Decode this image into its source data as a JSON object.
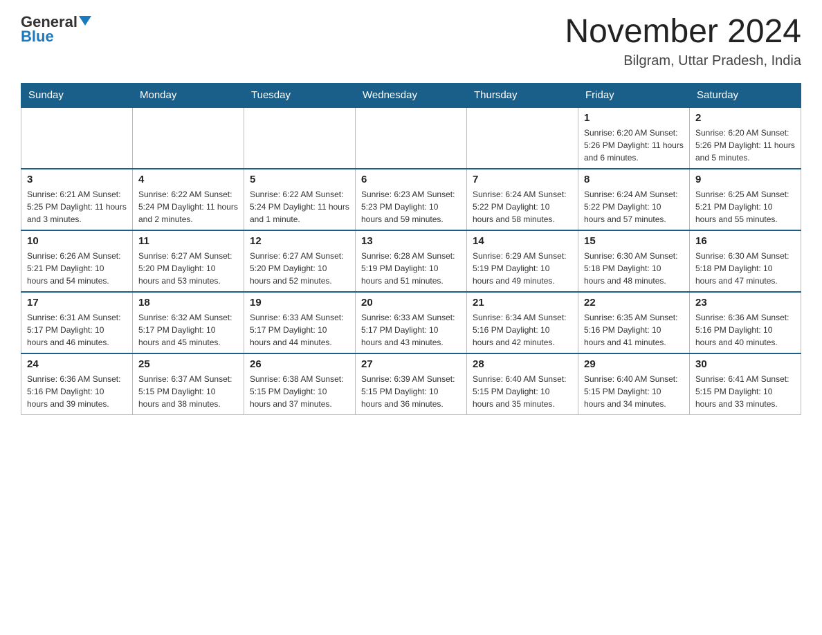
{
  "header": {
    "logo_general": "General",
    "logo_blue": "Blue",
    "title": "November 2024",
    "subtitle": "Bilgram, Uttar Pradesh, India"
  },
  "calendar": {
    "days_of_week": [
      "Sunday",
      "Monday",
      "Tuesday",
      "Wednesday",
      "Thursday",
      "Friday",
      "Saturday"
    ],
    "weeks": [
      [
        {
          "day": "",
          "info": ""
        },
        {
          "day": "",
          "info": ""
        },
        {
          "day": "",
          "info": ""
        },
        {
          "day": "",
          "info": ""
        },
        {
          "day": "",
          "info": ""
        },
        {
          "day": "1",
          "info": "Sunrise: 6:20 AM\nSunset: 5:26 PM\nDaylight: 11 hours and 6 minutes."
        },
        {
          "day": "2",
          "info": "Sunrise: 6:20 AM\nSunset: 5:26 PM\nDaylight: 11 hours and 5 minutes."
        }
      ],
      [
        {
          "day": "3",
          "info": "Sunrise: 6:21 AM\nSunset: 5:25 PM\nDaylight: 11 hours and 3 minutes."
        },
        {
          "day": "4",
          "info": "Sunrise: 6:22 AM\nSunset: 5:24 PM\nDaylight: 11 hours and 2 minutes."
        },
        {
          "day": "5",
          "info": "Sunrise: 6:22 AM\nSunset: 5:24 PM\nDaylight: 11 hours and 1 minute."
        },
        {
          "day": "6",
          "info": "Sunrise: 6:23 AM\nSunset: 5:23 PM\nDaylight: 10 hours and 59 minutes."
        },
        {
          "day": "7",
          "info": "Sunrise: 6:24 AM\nSunset: 5:22 PM\nDaylight: 10 hours and 58 minutes."
        },
        {
          "day": "8",
          "info": "Sunrise: 6:24 AM\nSunset: 5:22 PM\nDaylight: 10 hours and 57 minutes."
        },
        {
          "day": "9",
          "info": "Sunrise: 6:25 AM\nSunset: 5:21 PM\nDaylight: 10 hours and 55 minutes."
        }
      ],
      [
        {
          "day": "10",
          "info": "Sunrise: 6:26 AM\nSunset: 5:21 PM\nDaylight: 10 hours and 54 minutes."
        },
        {
          "day": "11",
          "info": "Sunrise: 6:27 AM\nSunset: 5:20 PM\nDaylight: 10 hours and 53 minutes."
        },
        {
          "day": "12",
          "info": "Sunrise: 6:27 AM\nSunset: 5:20 PM\nDaylight: 10 hours and 52 minutes."
        },
        {
          "day": "13",
          "info": "Sunrise: 6:28 AM\nSunset: 5:19 PM\nDaylight: 10 hours and 51 minutes."
        },
        {
          "day": "14",
          "info": "Sunrise: 6:29 AM\nSunset: 5:19 PM\nDaylight: 10 hours and 49 minutes."
        },
        {
          "day": "15",
          "info": "Sunrise: 6:30 AM\nSunset: 5:18 PM\nDaylight: 10 hours and 48 minutes."
        },
        {
          "day": "16",
          "info": "Sunrise: 6:30 AM\nSunset: 5:18 PM\nDaylight: 10 hours and 47 minutes."
        }
      ],
      [
        {
          "day": "17",
          "info": "Sunrise: 6:31 AM\nSunset: 5:17 PM\nDaylight: 10 hours and 46 minutes."
        },
        {
          "day": "18",
          "info": "Sunrise: 6:32 AM\nSunset: 5:17 PM\nDaylight: 10 hours and 45 minutes."
        },
        {
          "day": "19",
          "info": "Sunrise: 6:33 AM\nSunset: 5:17 PM\nDaylight: 10 hours and 44 minutes."
        },
        {
          "day": "20",
          "info": "Sunrise: 6:33 AM\nSunset: 5:17 PM\nDaylight: 10 hours and 43 minutes."
        },
        {
          "day": "21",
          "info": "Sunrise: 6:34 AM\nSunset: 5:16 PM\nDaylight: 10 hours and 42 minutes."
        },
        {
          "day": "22",
          "info": "Sunrise: 6:35 AM\nSunset: 5:16 PM\nDaylight: 10 hours and 41 minutes."
        },
        {
          "day": "23",
          "info": "Sunrise: 6:36 AM\nSunset: 5:16 PM\nDaylight: 10 hours and 40 minutes."
        }
      ],
      [
        {
          "day": "24",
          "info": "Sunrise: 6:36 AM\nSunset: 5:16 PM\nDaylight: 10 hours and 39 minutes."
        },
        {
          "day": "25",
          "info": "Sunrise: 6:37 AM\nSunset: 5:15 PM\nDaylight: 10 hours and 38 minutes."
        },
        {
          "day": "26",
          "info": "Sunrise: 6:38 AM\nSunset: 5:15 PM\nDaylight: 10 hours and 37 minutes."
        },
        {
          "day": "27",
          "info": "Sunrise: 6:39 AM\nSunset: 5:15 PM\nDaylight: 10 hours and 36 minutes."
        },
        {
          "day": "28",
          "info": "Sunrise: 6:40 AM\nSunset: 5:15 PM\nDaylight: 10 hours and 35 minutes."
        },
        {
          "day": "29",
          "info": "Sunrise: 6:40 AM\nSunset: 5:15 PM\nDaylight: 10 hours and 34 minutes."
        },
        {
          "day": "30",
          "info": "Sunrise: 6:41 AM\nSunset: 5:15 PM\nDaylight: 10 hours and 33 minutes."
        }
      ]
    ]
  }
}
